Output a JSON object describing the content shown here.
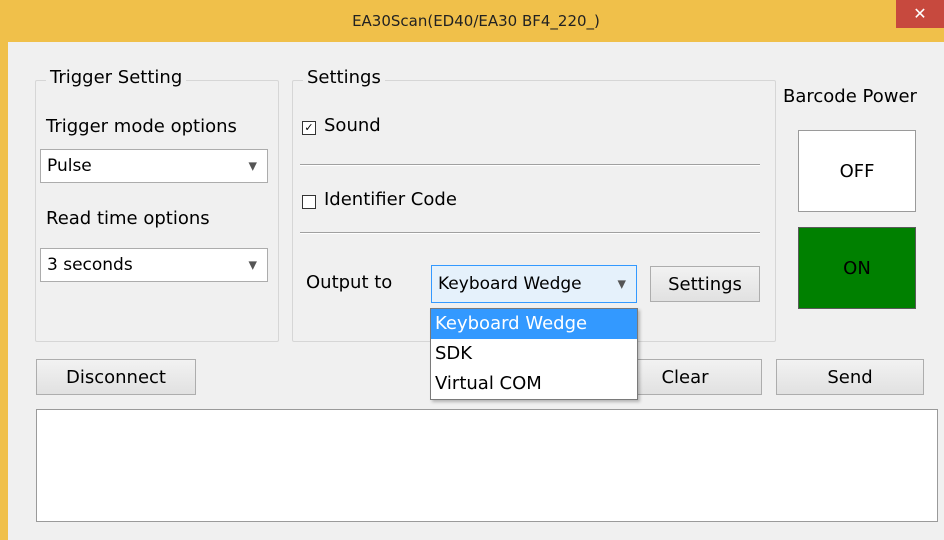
{
  "window": {
    "title": "EA30Scan(ED40/EA30 BF4_220_)",
    "close_glyph": "✕"
  },
  "trigger": {
    "title": "Trigger Setting",
    "mode_label": "Trigger mode options",
    "mode_value": "Pulse",
    "read_label": "Read time options",
    "read_value": "3 seconds"
  },
  "settings": {
    "title": "Settings",
    "sound_label": "Sound",
    "sound_checked": true,
    "identifier_label": "Identifier Code",
    "identifier_checked": false,
    "output_label": "Output to",
    "output_value": "Keyboard Wedge",
    "settings_button": "Settings",
    "output_options": [
      "Keyboard Wedge",
      "SDK",
      "Virtual COM"
    ]
  },
  "barcode_power": {
    "title": "Barcode Power",
    "off_label": "OFF",
    "on_label": "ON",
    "on_color": "#008000"
  },
  "actions": {
    "disconnect": "Disconnect",
    "clear": "Clear",
    "send": "Send"
  },
  "glyphs": {
    "checked": "✓",
    "chevron": "⌄"
  }
}
